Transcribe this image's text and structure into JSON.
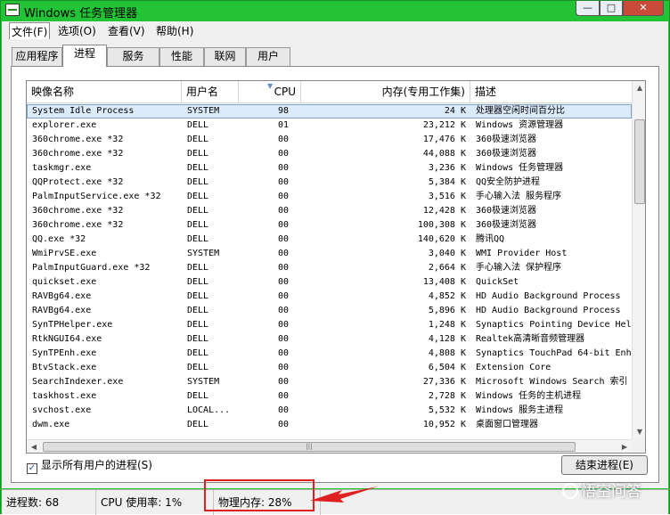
{
  "window": {
    "title": "Windows 任务管理器",
    "controls": {
      "minimize": "—",
      "maximize": "□",
      "close": "✕"
    }
  },
  "menu": {
    "file": "文件(F)",
    "options": "选项(O)",
    "view": "查看(V)",
    "help": "帮助(H)"
  },
  "tabs": {
    "apps": "应用程序",
    "processes": "进程",
    "services": "服务",
    "performance": "性能",
    "network": "联网",
    "users": "用户",
    "active": "processes"
  },
  "table": {
    "headers": {
      "name": "映像名称",
      "user": "用户名",
      "cpu": "CPU",
      "memory": "内存(专用工作集)",
      "description": "描述"
    },
    "sorted_column": "cpu",
    "rows": [
      {
        "name": "System Idle Process",
        "user": "SYSTEM",
        "cpu": "98",
        "mem": "24 K",
        "desc": "处理器空闲时间百分比",
        "selected": true
      },
      {
        "name": "explorer.exe",
        "user": "DELL",
        "cpu": "01",
        "mem": "23,212 K",
        "desc": "Windows 资源管理器"
      },
      {
        "name": "360chrome.exe *32",
        "user": "DELL",
        "cpu": "00",
        "mem": "17,476 K",
        "desc": "360极速浏览器"
      },
      {
        "name": "360chrome.exe *32",
        "user": "DELL",
        "cpu": "00",
        "mem": "44,088 K",
        "desc": "360极速浏览器"
      },
      {
        "name": "taskmgr.exe",
        "user": "DELL",
        "cpu": "00",
        "mem": "3,236 K",
        "desc": "Windows 任务管理器"
      },
      {
        "name": "QQProtect.exe *32",
        "user": "DELL",
        "cpu": "00",
        "mem": "5,384 K",
        "desc": "QQ安全防护进程"
      },
      {
        "name": "PalmInputService.exe *32",
        "user": "DELL",
        "cpu": "00",
        "mem": "3,516 K",
        "desc": "手心输入法 服务程序"
      },
      {
        "name": "360chrome.exe *32",
        "user": "DELL",
        "cpu": "00",
        "mem": "12,428 K",
        "desc": "360极速浏览器"
      },
      {
        "name": "360chrome.exe *32",
        "user": "DELL",
        "cpu": "00",
        "mem": "100,308 K",
        "desc": "360极速浏览器"
      },
      {
        "name": "QQ.exe *32",
        "user": "DELL",
        "cpu": "00",
        "mem": "140,620 K",
        "desc": "腾讯QQ"
      },
      {
        "name": "WmiPrvSE.exe",
        "user": "SYSTEM",
        "cpu": "00",
        "mem": "3,040 K",
        "desc": "WMI Provider Host"
      },
      {
        "name": "PalmInputGuard.exe *32",
        "user": "DELL",
        "cpu": "00",
        "mem": "2,664 K",
        "desc": "手心输入法 保护程序"
      },
      {
        "name": "quickset.exe",
        "user": "DELL",
        "cpu": "00",
        "mem": "13,408 K",
        "desc": "QuickSet"
      },
      {
        "name": "RAVBg64.exe",
        "user": "DELL",
        "cpu": "00",
        "mem": "4,852 K",
        "desc": "HD Audio Background Process"
      },
      {
        "name": "RAVBg64.exe",
        "user": "DELL",
        "cpu": "00",
        "mem": "5,896 K",
        "desc": "HD Audio Background Process"
      },
      {
        "name": "SynTPHelper.exe",
        "user": "DELL",
        "cpu": "00",
        "mem": "1,248 K",
        "desc": "Synaptics Pointing Device Hel"
      },
      {
        "name": "RtkNGUI64.exe",
        "user": "DELL",
        "cpu": "00",
        "mem": "4,128 K",
        "desc": "Realtek高清晰音频管理器"
      },
      {
        "name": "SynTPEnh.exe",
        "user": "DELL",
        "cpu": "00",
        "mem": "4,808 K",
        "desc": "Synaptics TouchPad 64-bit Enh"
      },
      {
        "name": "BtvStack.exe",
        "user": "DELL",
        "cpu": "00",
        "mem": "6,504 K",
        "desc": "Extension Core"
      },
      {
        "name": "SearchIndexer.exe",
        "user": "SYSTEM",
        "cpu": "00",
        "mem": "27,336 K",
        "desc": "Microsoft Windows Search 索引"
      },
      {
        "name": "taskhost.exe",
        "user": "DELL",
        "cpu": "00",
        "mem": "2,728 K",
        "desc": "Windows 任务的主机进程"
      },
      {
        "name": "svchost.exe",
        "user": "LOCAL...",
        "cpu": "00",
        "mem": "5,532 K",
        "desc": "Windows 服务主进程"
      },
      {
        "name": "dwm.exe",
        "user": "DELL",
        "cpu": "00",
        "mem": "10,952 K",
        "desc": "桌面窗口管理器"
      }
    ]
  },
  "scrollbars": {
    "up": "▲",
    "down": "▼",
    "left": "◀",
    "right": "▶",
    "grip": "|||"
  },
  "controls": {
    "show_all_users": "显示所有用户的进程(S)",
    "show_all_checked": true,
    "check_mark": "✓",
    "end_process": "结束进程(E)"
  },
  "status": {
    "processes": "进程数: 68",
    "cpu": "CPU 使用率: 1%",
    "memory": "物理内存: 28%"
  },
  "annotation": {
    "highlight_color": "#e02020"
  },
  "watermark": "悟空问答",
  "colors": {
    "frame": "#22c435",
    "selection": "#dcebfc"
  }
}
